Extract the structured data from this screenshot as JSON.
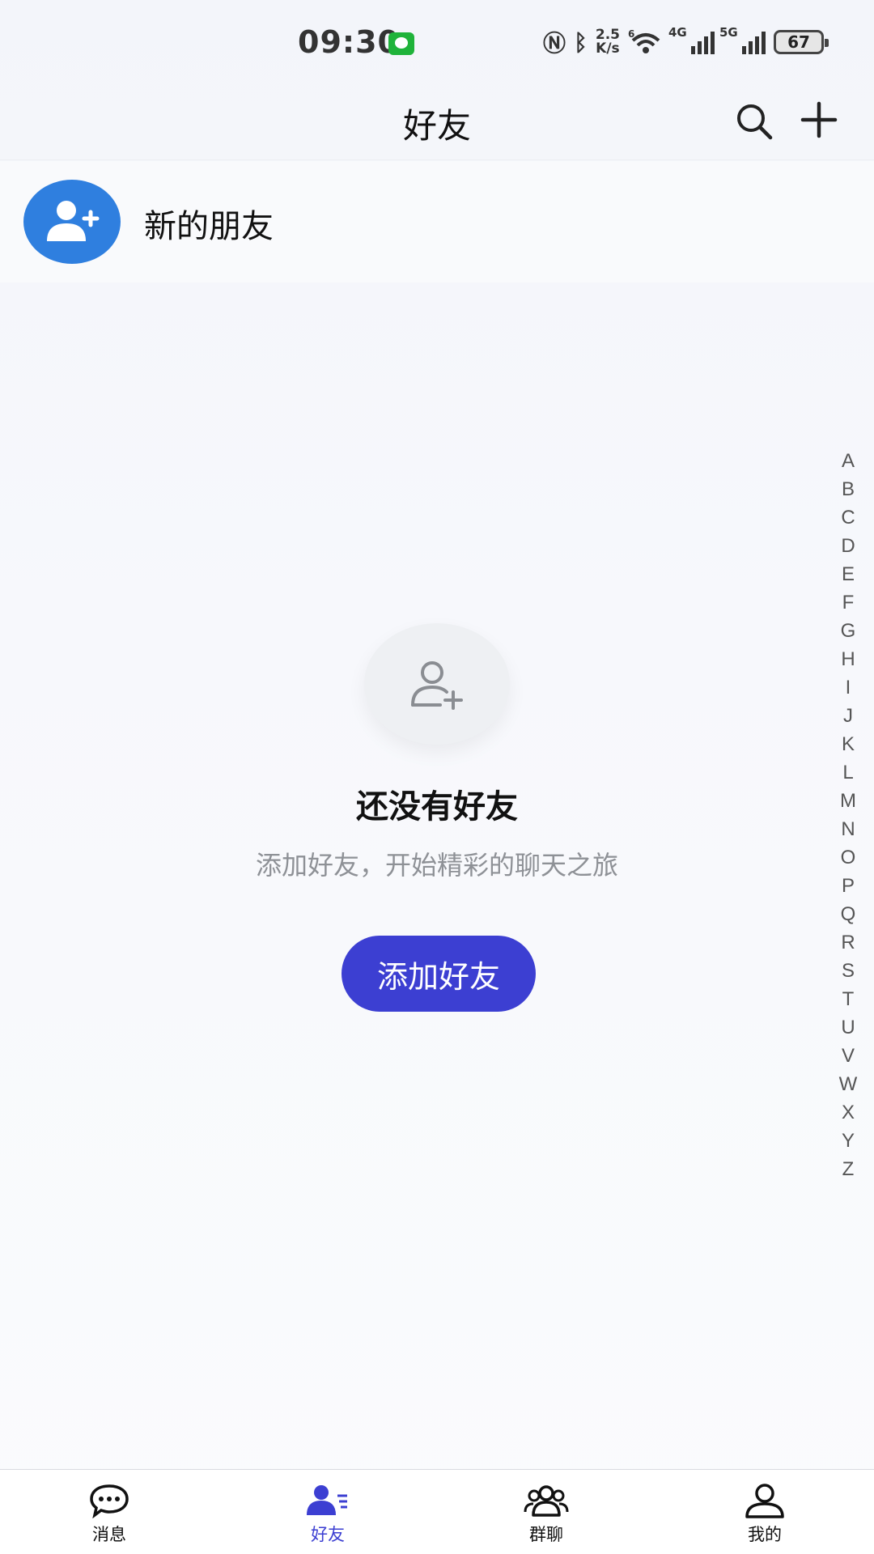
{
  "status_bar": {
    "time": "09:30",
    "net_speed_value": "2.5",
    "net_speed_unit": "K/s",
    "wifi_label": "6",
    "signal1_label": "4G",
    "signal2_label": "5G",
    "battery": "67"
  },
  "header": {
    "title": "好友",
    "search_icon": "search-icon",
    "add_icon": "plus-icon"
  },
  "new_friends": {
    "label": "新的朋友",
    "icon": "add-user-icon"
  },
  "empty_state": {
    "icon": "add-user-outline-icon",
    "title": "还没有好友",
    "subtitle": "添加好友，开始精彩的聊天之旅",
    "button_label": "添加好友"
  },
  "alphabet_index": [
    "A",
    "B",
    "C",
    "D",
    "E",
    "F",
    "G",
    "H",
    "I",
    "J",
    "K",
    "L",
    "M",
    "N",
    "O",
    "P",
    "Q",
    "R",
    "S",
    "T",
    "U",
    "V",
    "W",
    "X",
    "Y",
    "Z"
  ],
  "tabs": [
    {
      "label": "消息",
      "icon": "chat-bubble-icon",
      "active": false
    },
    {
      "label": "好友",
      "icon": "contacts-icon",
      "active": true
    },
    {
      "label": "群聊",
      "icon": "group-icon",
      "active": false
    },
    {
      "label": "我的",
      "icon": "profile-icon",
      "active": false
    }
  ],
  "colors": {
    "accent": "#3c3fd2",
    "avatar_blue": "#2f7fdf"
  }
}
